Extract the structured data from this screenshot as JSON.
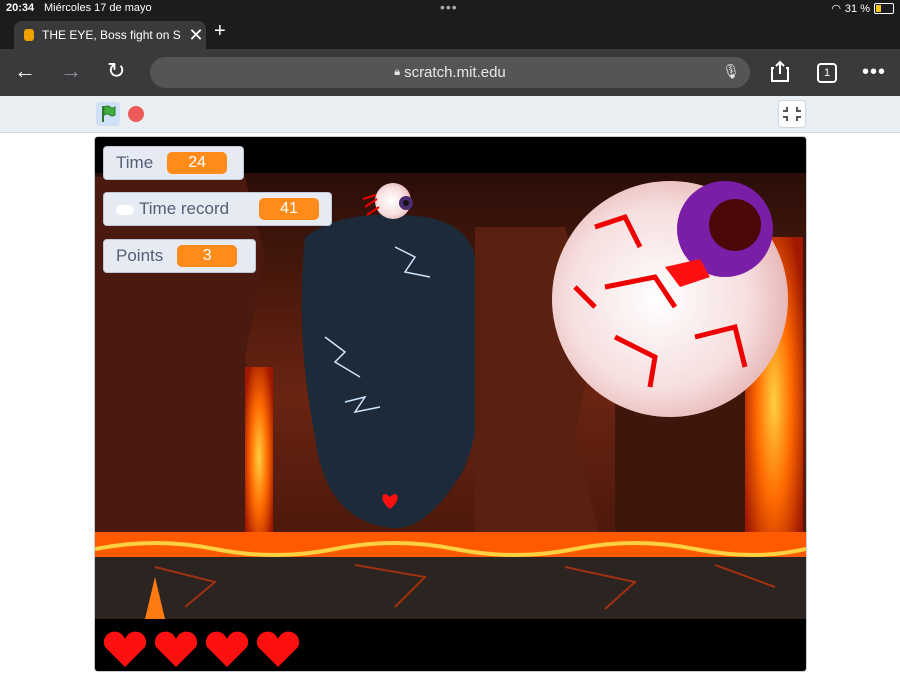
{
  "status_bar": {
    "time": "20:34",
    "date": "Miércoles 17 de mayo",
    "battery_text": "31 %"
  },
  "browser": {
    "tab_title": "THE EYE, Boss fight on S",
    "url": "scratch.mit.edu",
    "tab_count": "1"
  },
  "game": {
    "monitors": {
      "time_label": "Time",
      "time_value": "24",
      "record_label": "Time record",
      "record_value": "41",
      "points_label": "Points",
      "points_value": "3"
    },
    "lives": 4
  },
  "colors": {
    "accent_orange": "#ff8c1a",
    "lava": "#ff6a00",
    "eye_iris": "#7a1ea8",
    "heart": "#ff1010"
  }
}
